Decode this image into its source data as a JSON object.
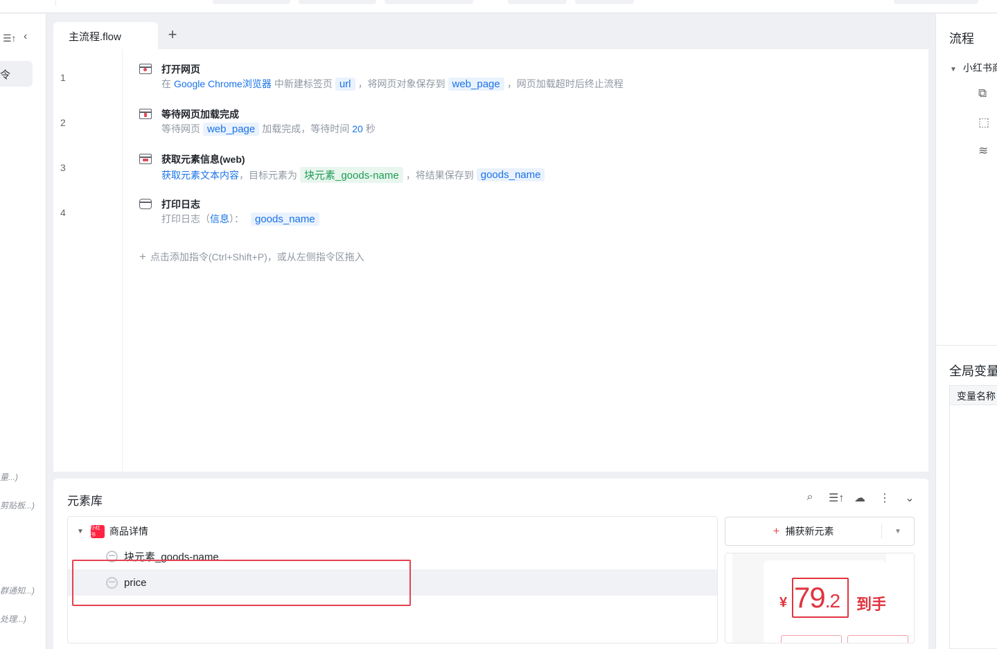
{
  "editor": {
    "tab_label": "主流程.flow",
    "add_tab": "+",
    "commands": [
      {
        "line": "1",
        "title": "打开网页",
        "desc": {
          "t1": "在",
          "browser": "Google Chrome浏览器",
          "t2": "中新建标签页",
          "url_var": "url",
          "t3": "，将网页对象保存到",
          "page_var": "web_page",
          "t4": "，网页加载超时后终止流程"
        }
      },
      {
        "line": "2",
        "title": "等待网页加载完成",
        "desc": {
          "t1": "等待网页",
          "page_var": "web_page",
          "t2": "加载完成，等待时间",
          "seconds": "20",
          "t3": "秒"
        }
      },
      {
        "line": "3",
        "title": "获取元素信息(web)",
        "desc": {
          "action": "获取元素文本内容",
          "t1": "，目标元素为",
          "element": "块元素_goods-name",
          "t2": "，将结果保存到",
          "result_var": "goods_name"
        }
      },
      {
        "line": "4",
        "title": "打印日志",
        "desc": {
          "t1": "打印日志（",
          "field": "信息",
          "t2": "）：",
          "var": "goods_name"
        }
      }
    ],
    "add_hint": "点击添加指令(Ctrl+Shift+P)，或从左侧指令区拖入"
  },
  "left_sidebar": {
    "active_item": "令",
    "cut_items": [
      "量...)",
      "剪贴板...)",
      "群通知...)",
      "处理...)"
    ]
  },
  "element_library": {
    "title": "元素库",
    "group": {
      "logo_text": "小红书",
      "label": "商品详情"
    },
    "items": [
      {
        "label": "块元素_goods-name"
      },
      {
        "label": "price"
      }
    ],
    "capture_button": "捕获新元素",
    "preview": {
      "currency": "¥",
      "price_int": "79",
      "price_dec": ".2",
      "after": "到手"
    }
  },
  "right_panel": {
    "flow_title": "流程",
    "flow_item": "小红书商",
    "vars_title": "全局变量",
    "vars_column": "变量名称"
  },
  "colors": {
    "link": "#1a73e8",
    "element_green": "#1d9b55",
    "highlight_red": "#e6404f",
    "brand_red": "#ff2442"
  }
}
